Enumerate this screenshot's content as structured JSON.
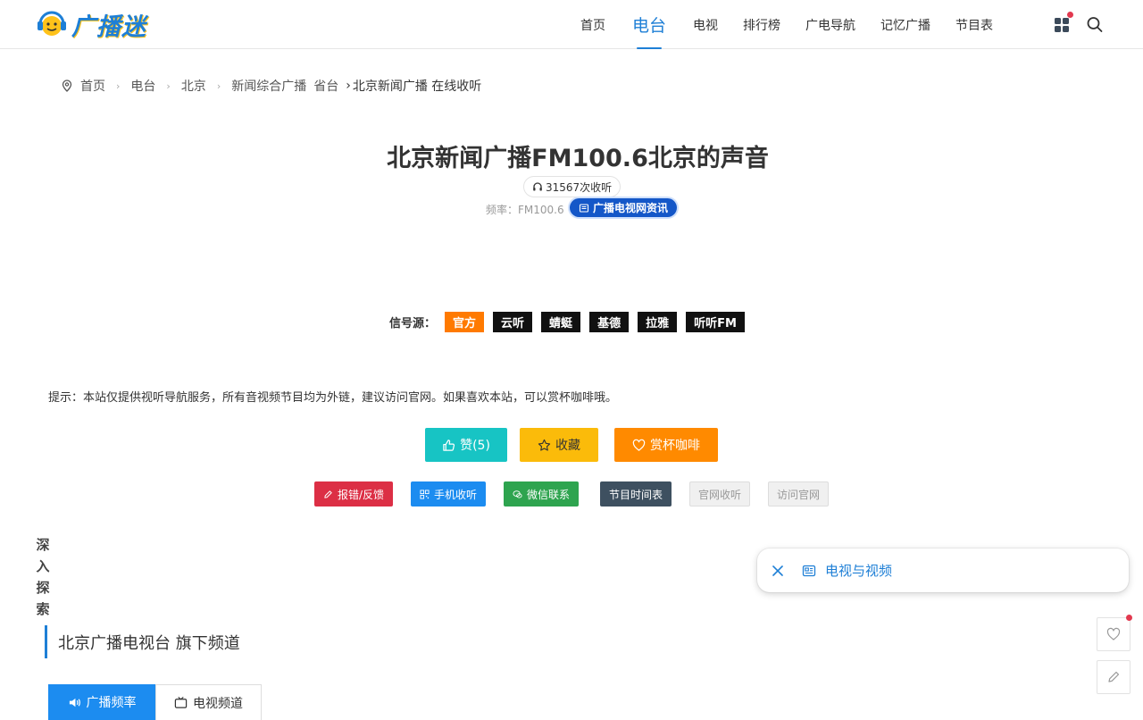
{
  "header": {
    "logo_text": "广播迷",
    "nav": [
      {
        "label": "首页",
        "active": false
      },
      {
        "label": "电台",
        "active": true
      },
      {
        "label": "电视",
        "active": false
      },
      {
        "label": "排行榜",
        "active": false
      },
      {
        "label": "广电导航",
        "active": false
      },
      {
        "label": "记忆广播",
        "active": false
      },
      {
        "label": "节目表",
        "active": false
      }
    ],
    "icons": [
      "apps-grid-icon",
      "search-icon"
    ]
  },
  "breadcrumb": {
    "items": [
      "首页",
      "电台",
      "北京",
      "新闻综合广播",
      "省台"
    ],
    "current": "北京新闻广播 在线收听"
  },
  "station": {
    "title": "北京新闻广播FM100.6北京的声音",
    "listen_count": "31567次收听",
    "frequency": "频率：FM100.6",
    "category": "广播电视网资讯"
  },
  "signal": {
    "label": "信号源：",
    "sources": [
      "官方",
      "云听",
      "蜻蜓",
      "基德",
      "拉雅",
      "听听FM"
    ]
  },
  "tip": "提示：本站仅提供视听导航服务，所有音视频节目均为外链，建议访问官网。如果喜欢本站，可以赏杯咖啡哦。",
  "actions": {
    "like": "赞(5)",
    "favorite": "收藏",
    "coffee": "赏杯咖啡",
    "report": "报错/反馈",
    "mobile": "手机收听",
    "wechat": "微信联系",
    "schedule": "节目时间表",
    "official_listen": "官网收听",
    "visit_official": "访问官网"
  },
  "explore_label": [
    "深",
    "入",
    "探",
    "索"
  ],
  "float_panel": {
    "label": "电视与视频"
  },
  "section": {
    "title": "北京广播电视台 旗下频道",
    "tabs": [
      "广播频率",
      "电视频道"
    ]
  },
  "colors": {
    "accent": "#1e7fd6",
    "official_source": "#ff7a00",
    "like": "#17c4c4",
    "favorite": "#fbbb0a",
    "coffee": "#ff8a00",
    "report": "#dc2f45",
    "wechat": "#2ea44f"
  }
}
